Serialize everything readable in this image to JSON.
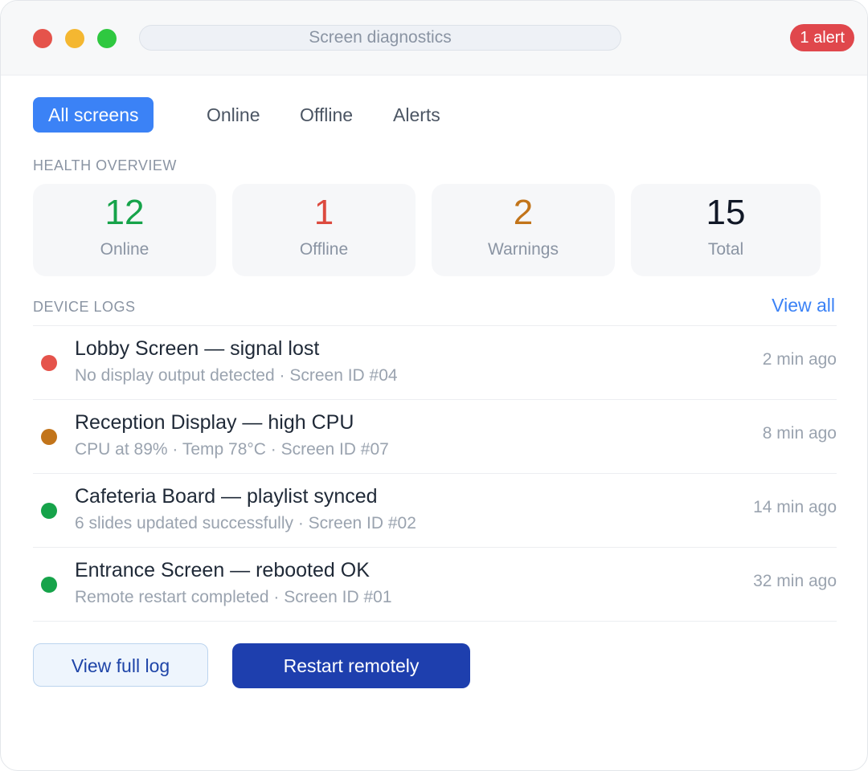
{
  "window": {
    "title": "Screen diagnostics",
    "alert_badge": "1 alert"
  },
  "tabs": [
    {
      "label": "All screens",
      "active": true
    },
    {
      "label": "Online",
      "active": false
    },
    {
      "label": "Offline",
      "active": false
    },
    {
      "label": "Alerts",
      "active": false
    }
  ],
  "health": {
    "heading": "HEALTH OVERVIEW",
    "stats": [
      {
        "value": "12",
        "label": "Online",
        "color": "#16a34a"
      },
      {
        "value": "1",
        "label": "Offline",
        "color": "#dc4a3f"
      },
      {
        "value": "2",
        "label": "Warnings",
        "color": "#c2741a"
      },
      {
        "value": "15",
        "label": "Total",
        "color": "#111827"
      }
    ]
  },
  "logs": {
    "heading": "DEVICE LOGS",
    "view_all": "View all",
    "items": [
      {
        "title": "Lobby Screen — signal lost",
        "subtitle": "No display output detected · Screen ID #04",
        "time": "2 min ago",
        "status_color": "#e5534b"
      },
      {
        "title": "Reception Display — high CPU",
        "subtitle": "CPU at 89% · Temp 78°C · Screen ID #07",
        "time": "8 min ago",
        "status_color": "#c2741a"
      },
      {
        "title": "Cafeteria Board — playlist synced",
        "subtitle": "6 slides updated successfully · Screen ID #02",
        "time": "14 min ago",
        "status_color": "#16a34a"
      },
      {
        "title": "Entrance Screen — rebooted OK",
        "subtitle": "Remote restart completed · Screen ID #01",
        "time": "32 min ago",
        "status_color": "#16a34a"
      }
    ]
  },
  "actions": {
    "view_full_log": "View full log",
    "restart_remotely": "Restart remotely"
  }
}
